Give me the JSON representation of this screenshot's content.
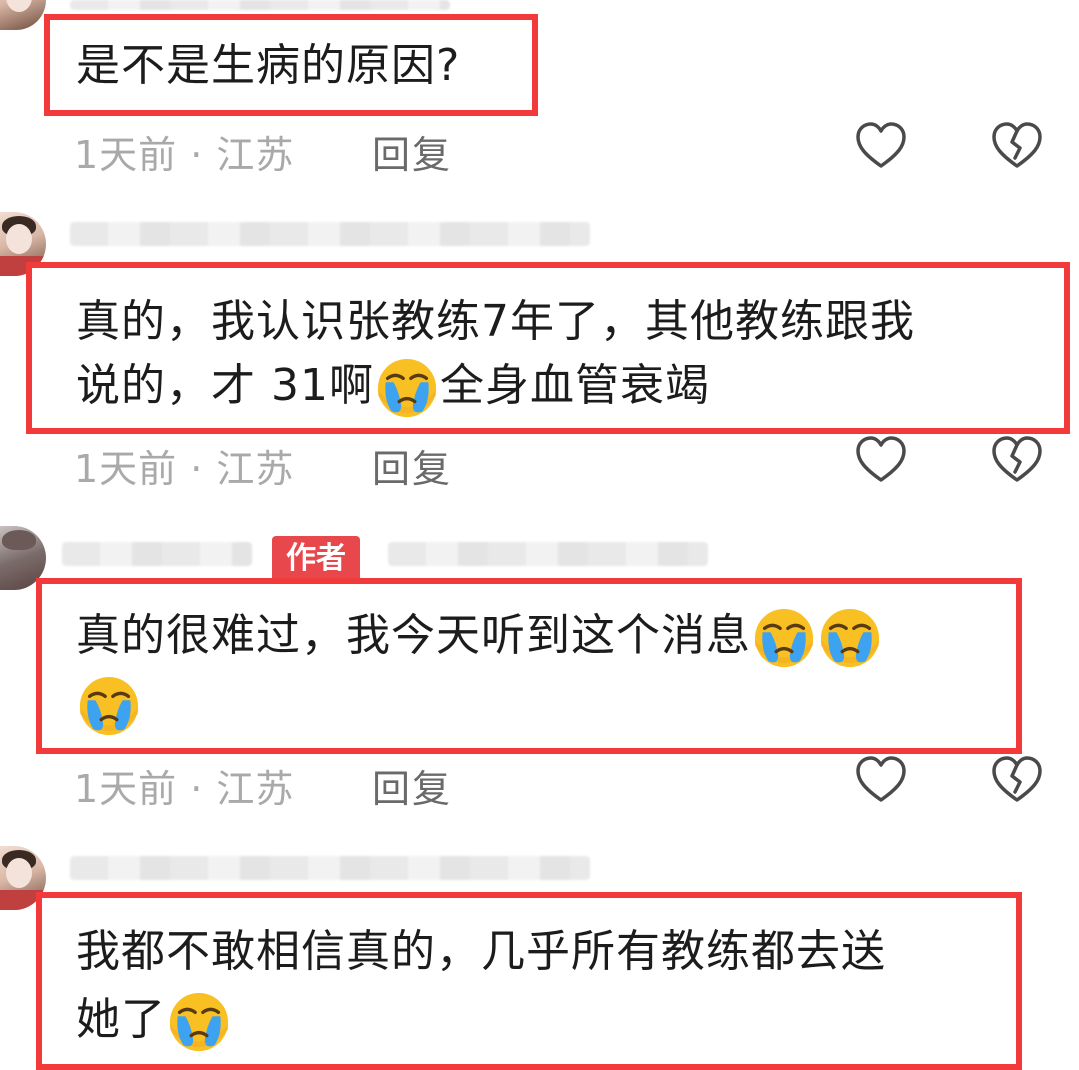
{
  "comments": [
    {
      "text_lines": [
        "是不是生病的原因?"
      ],
      "meta": "1天前 · 江苏",
      "reply_label": "回复"
    },
    {
      "text_lines": [
        "真的，我认识张教练7年了，其他教练跟我",
        "说的，才 31啊",
        "全身血管衰竭"
      ],
      "meta": "1天前 · 江苏",
      "reply_label": "回复"
    },
    {
      "author_badge": "作者",
      "text_lines": [
        "真的很难过，我今天听到这个消息"
      ],
      "meta": "1天前 · 江苏",
      "reply_label": "回复"
    },
    {
      "text_lines": [
        "我都不敢相信真的，几乎所有教练都去送",
        "她了"
      ]
    }
  ],
  "icons": {
    "like": "heart-outline-icon",
    "dislike": "broken-heart-icon",
    "emoji": "crying-face-emoji"
  },
  "colors": {
    "highlight_border": "#f23a3a",
    "author_badge": "#e8474c",
    "meta_text": "#a9a9a9",
    "emoji_face": "#fbc02d",
    "emoji_tears": "#42a5f5"
  }
}
